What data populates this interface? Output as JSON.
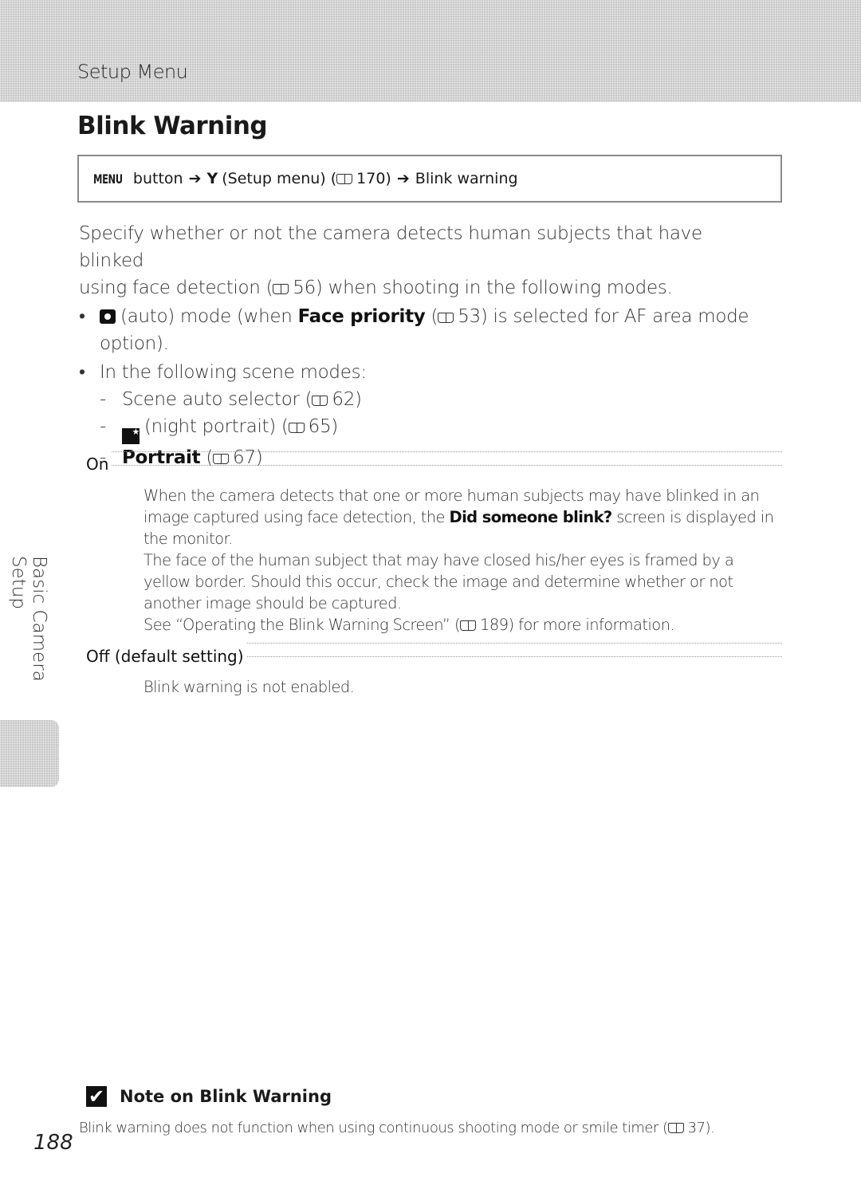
{
  "header": {
    "section": "Setup Menu"
  },
  "title": "Blink Warning",
  "nav_path": {
    "menu_key": "MENU",
    "button_word": "button",
    "arrow": "➔",
    "wrench": "Y",
    "setup_menu": "(Setup menu) (",
    "ref_page": "170)",
    "target": "Blink warning"
  },
  "intro": {
    "line1": "Specify whether or not the camera detects human subjects that have blinked",
    "line2_pre": "using face detection (",
    "line2_ref": "56) when shooting in the following modes.",
    "bullet_dot": "•",
    "bullet1_mid": "(auto) mode (when ",
    "bullet1_bold": "Face priority",
    "bullet1_open": " (",
    "bullet1_ref": "53) is selected for AF area mode",
    "bullet1_cont": "option).",
    "bullet2": "In the following scene modes:",
    "dash": "-",
    "sub1_pre": "Scene auto selector (",
    "sub1_ref": "62)",
    "sub2_pre": "(night portrait) (",
    "sub2_ref": "65)",
    "sub3_bold": "Portrait",
    "sub3_open": " (",
    "sub3_ref": "67)"
  },
  "options": [
    {
      "label": "On",
      "desc": {
        "p1_pre": "When the camera detects that one or more human subjects may have blinked in an image captured using face detection, the ",
        "p1_bold": "Did someone blink?",
        "p1_post": " screen is displayed in the monitor.",
        "p2": "The face of the human subject that may have closed his/her eyes is framed by a yellow border. Should this occur, check the image and determine whether or not another image should be captured.",
        "p3_pre": "See “Operating the Blink Warning Screen” (",
        "p3_ref": "189) for more information."
      }
    },
    {
      "label": "Off (default setting)",
      "desc": {
        "p1": "Blink warning is not enabled."
      }
    }
  ],
  "side_tab": "Basic Camera Setup",
  "note": {
    "icon_glyph": "✔",
    "title": "Note on Blink Warning",
    "text_pre": "Blink warning does not function when using continuous shooting mode or smile timer (",
    "text_ref": "37)."
  },
  "page_number": "188"
}
